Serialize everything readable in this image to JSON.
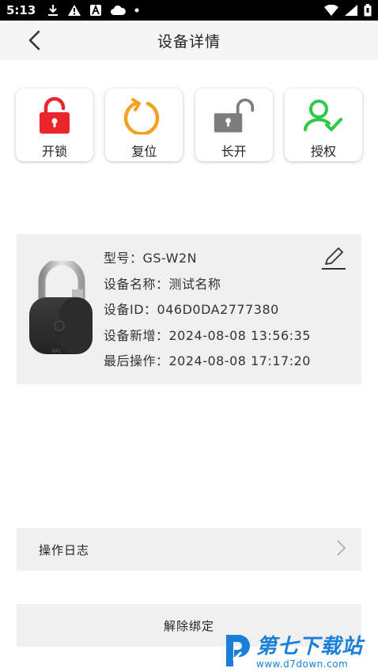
{
  "status_bar": {
    "time": "5:13"
  },
  "header": {
    "title": "设备详情"
  },
  "actions": [
    {
      "label": "开锁",
      "icon": "unlock-red-icon",
      "color": "#e8262b"
    },
    {
      "label": "复位",
      "icon": "reset-icon",
      "color": "#f0a11e"
    },
    {
      "label": "长开",
      "icon": "unlock-gray-icon",
      "color": "#888888"
    },
    {
      "label": "授权",
      "icon": "authorize-user-icon",
      "color": "#2ec94a"
    }
  ],
  "device": {
    "model": "型号：GS-W2N",
    "name": "设备名称：测试名称",
    "id": "设备ID：046D0DA2777380",
    "added": "设备新增：2024-08-08 13:56:35",
    "last_op": "最后操作：2024-08-08 17:17:20",
    "lock_badge": "NFC"
  },
  "log": {
    "label": "操作日志"
  },
  "unbind": {
    "label": "解除绑定"
  },
  "watermark": {
    "main": "第七下载站",
    "sub": "www.d7down.com"
  }
}
